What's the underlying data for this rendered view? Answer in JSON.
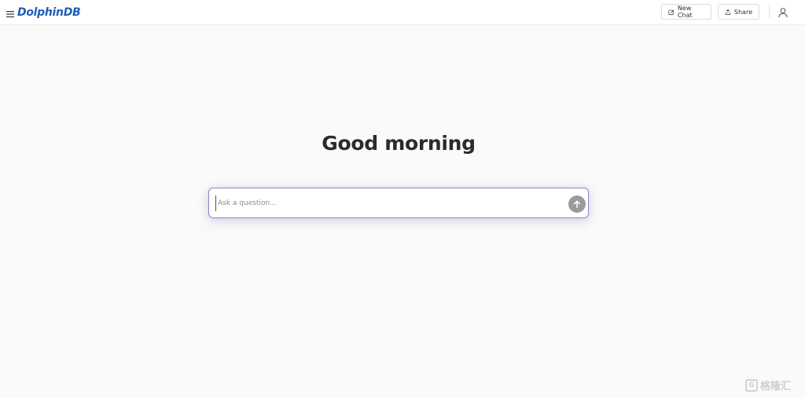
{
  "header": {
    "logo_text": "DolphinDB",
    "new_chat_label": "New Chat",
    "share_label": "Share"
  },
  "main": {
    "greeting": "Good morning",
    "input_placeholder": "Ask a question..."
  },
  "watermark": {
    "text": "格隆汇",
    "mark": "G"
  },
  "colors": {
    "logo": "#1f5fb5",
    "send_button": "#9a9a9a",
    "input_border": "#8a87c9"
  },
  "icons": [
    "menu-icon",
    "edit-icon",
    "share-icon",
    "user-icon",
    "arrow-up-icon"
  ]
}
